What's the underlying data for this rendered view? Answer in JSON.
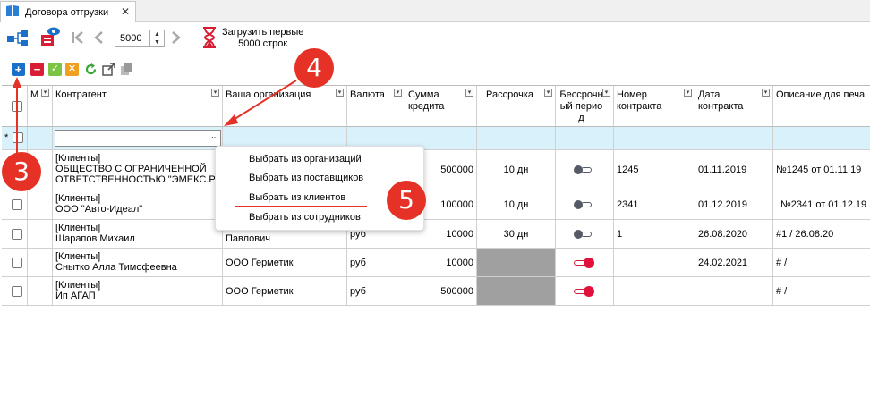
{
  "tab": {
    "title": "Договора отгрузки",
    "close": "✕"
  },
  "pager": {
    "value": "5000",
    "load_label_line1": "Загрузить первые",
    "load_label_line2": "5000 строк"
  },
  "columns": [
    {
      "label": "M"
    },
    {
      "label": "Контрагент"
    },
    {
      "label": "Ваша организация"
    },
    {
      "label": "Валюта"
    },
    {
      "label": "Сумма кредита"
    },
    {
      "label": "Рассрочка"
    },
    {
      "label": "Бессрочный период"
    },
    {
      "label": "Номер контракта"
    },
    {
      "label": "Дата контракта"
    },
    {
      "label": "Описание для печа"
    }
  ],
  "new_row_marker": "*",
  "ellipsis": "···",
  "rows": [
    {
      "counterparty": [
        "[Клиенты]",
        "ОБЩЕСТВО С ОГРАНИЧЕННОЙ",
        "ОТВЕТСТВЕННОСТЬЮ \"ЭМЕКС.РУ\""
      ],
      "org": "",
      "currency": "",
      "amount": "500000",
      "installment": "10 дн",
      "perpetual": false,
      "number": "1245",
      "date": "01.11.2019",
      "desc": "№1245 от 01.11.19"
    },
    {
      "counterparty": [
        "[Клиенты]",
        "ООО \"Авто-Идеал\""
      ],
      "org": "",
      "currency": "",
      "amount": "100000",
      "installment": "10 дн",
      "perpetual": false,
      "number": "2341",
      "date": "01.12.2019",
      "desc": "№2341 от 01.12.19"
    },
    {
      "counterparty": [
        "[Клиенты]",
        "Шарапов Михаил"
      ],
      "org": "Павлович",
      "currency": "руб",
      "amount": "10000",
      "installment": "30 дн",
      "perpetual": false,
      "number": "1",
      "date": "26.08.2020",
      "desc": "#1 / 26.08.20"
    },
    {
      "counterparty": [
        "[Клиенты]",
        "Снытко Алла Тимофеевна"
      ],
      "org": "ООО Герметик",
      "currency": "руб",
      "amount": "10000",
      "installment": "",
      "perpetual": true,
      "number": "",
      "date": "24.02.2021",
      "desc": "# /"
    },
    {
      "counterparty": [
        "[Клиенты]",
        "Ип АГАП"
      ],
      "org": "ООО Герметик",
      "currency": "руб",
      "amount": "500000",
      "installment": "",
      "perpetual": true,
      "number": "",
      "date": "",
      "desc": "# /"
    }
  ],
  "context_menu": {
    "items": [
      "Выбрать из организаций",
      "Выбрать из поставщиков",
      "Выбрать из клиентов",
      "Выбрать из сотрудников"
    ]
  },
  "annotations": {
    "m3": "3",
    "m4": "4",
    "m5": "5"
  },
  "colors": {
    "accent_red": "#e63226",
    "new_row_bg": "#d9f1fb",
    "toggle_on": "#e0113a",
    "toggle_off": "#555a66"
  }
}
